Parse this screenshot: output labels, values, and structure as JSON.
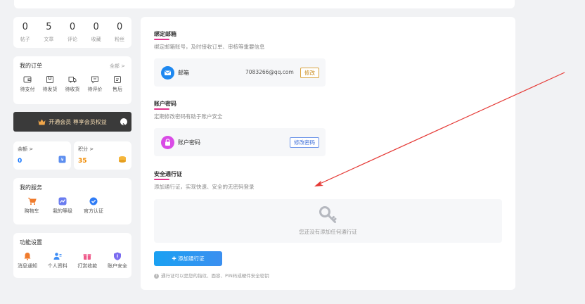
{
  "stats": [
    {
      "value": "0",
      "label": "帖子"
    },
    {
      "value": "5",
      "label": "文章"
    },
    {
      "value": "0",
      "label": "评论"
    },
    {
      "value": "0",
      "label": "收藏"
    },
    {
      "value": "0",
      "label": "粉丝"
    }
  ],
  "orders": {
    "title": "我的订单",
    "all_link": "全部 >",
    "items": [
      {
        "label": "待支付",
        "icon": "wallet-icon"
      },
      {
        "label": "待发货",
        "icon": "box-icon"
      },
      {
        "label": "待收货",
        "icon": "truck-icon"
      },
      {
        "label": "待评价",
        "icon": "comment-icon"
      },
      {
        "label": "售后",
        "icon": "aftersale-icon"
      }
    ]
  },
  "vip": {
    "label": "开通会员 尊享会员权益",
    "icon": "crown-icon"
  },
  "balance": {
    "label": "余额 >",
    "value": "0",
    "value_color": "#1677ff"
  },
  "points": {
    "label": "积分 >",
    "value": "35",
    "value_color": "#f08a00"
  },
  "services": {
    "title": "我的服务",
    "items": [
      {
        "label": "购物车",
        "icon": "cart-icon"
      },
      {
        "label": "我的等级",
        "icon": "level-icon"
      },
      {
        "label": "官方认证",
        "icon": "verified-icon"
      }
    ]
  },
  "settings": {
    "title": "功能设置",
    "items": [
      {
        "label": "消息通知",
        "icon": "bell-icon"
      },
      {
        "label": "个人资料",
        "icon": "profile-icon"
      },
      {
        "label": "打赏收款",
        "icon": "gift-icon"
      },
      {
        "label": "账户安全",
        "icon": "shield-icon"
      }
    ]
  },
  "email": {
    "title": "绑定邮箱",
    "desc": "绑定邮箱账号，及时接收订单、审核等重要信息",
    "label": "邮箱",
    "value": "7083266@qq.com",
    "button": "修改"
  },
  "password": {
    "title": "账户密码",
    "desc": "定期修改密码有助于账户安全",
    "label": "账户密码",
    "button": "修改密码"
  },
  "passkey": {
    "title": "安全通行证",
    "desc": "添加通行证，实现快速、安全的无密码登录",
    "empty": "您还没有添加任何通行证",
    "button": "添加通行证",
    "tip": "通行证可以是您的指纹、面容、PIN码或硬件安全密钥"
  },
  "colors": {
    "accent": "#e0348d",
    "primary": "#1677ff",
    "orange": "#f08a00",
    "annotation": "#e53935"
  }
}
